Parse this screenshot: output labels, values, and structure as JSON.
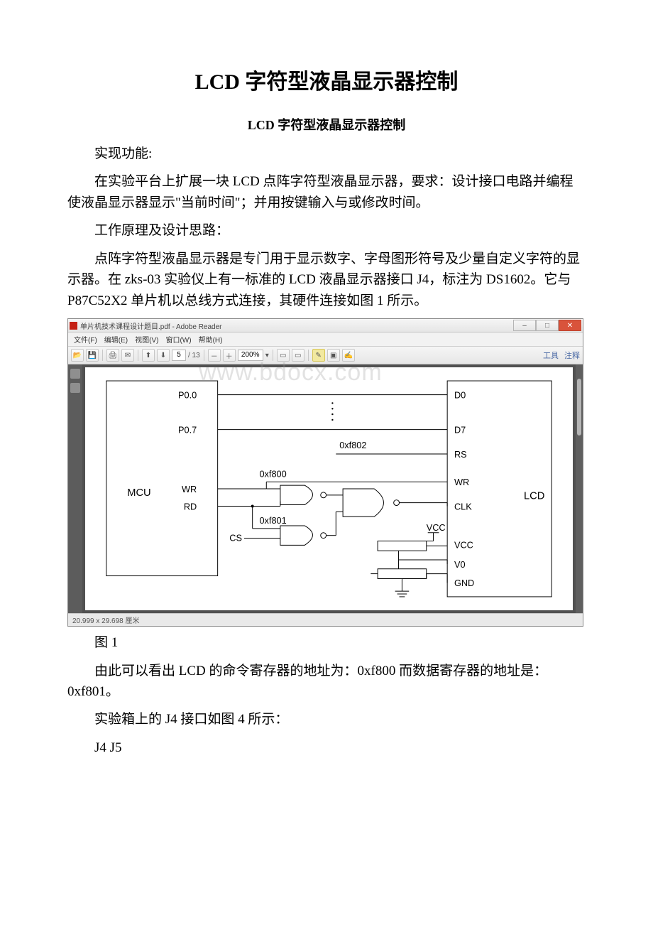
{
  "doc": {
    "title_main": "LCD 字符型液晶显示器控制",
    "subtitle": "LCD 字符型液晶显示器控制",
    "p_func_h": "实现功能:",
    "p_func_body": "在实验平台上扩展一块 LCD 点阵字符型液晶显示器，要求：设计接口电路并编程使液晶显示器显示\"当前时间\"；并用按键输入与或修改时间。",
    "p_principle_h": "工作原理及设计思路：",
    "p_principle_body": "点阵字符型液晶显示器是专门用于显示数字、字母图形符号及少量自定义字符的显示器。在 zks-03 实验仪上有一标准的 LCD 液晶显示器接口 J4，标注为 DS1602。它与 P87C52X2 单片机以总线方式连接，其硬件连接如图 1 所示。",
    "fig1_caption": "图 1",
    "p_conclusion": "由此可以看出 LCD 的命令寄存器的地址为：0xf800 而数据寄存器的地址是：0xf801。",
    "p_j4": "实验箱上的 J4 接口如图 4 所示：",
    "p_j4j5": "J4 J5"
  },
  "adobe": {
    "window_title": "单片机技术课程设计题目.pdf - Adobe Reader",
    "menu": [
      "文件(F)",
      "编辑(E)",
      "视图(V)",
      "窗口(W)",
      "帮助(H)"
    ],
    "page_current": "5",
    "page_total": "/ 13",
    "zoom": "200%",
    "right_links": [
      "工具",
      "注释"
    ],
    "status": "20.999 x 29.698 厘米"
  },
  "circuit": {
    "mcu": "MCU",
    "lcd": "LCD",
    "p00": "P0.0",
    "p07": "P0.7",
    "wr": "WR",
    "rd": "RD",
    "cs": "CS",
    "d0": "D0",
    "d7": "D7",
    "rs": "RS",
    "wr_r": "WR",
    "clk": "CLK",
    "vcc_top": "VCC",
    "vcc": "VCC",
    "v0": "V0",
    "gnd": "GND",
    "addr_a": "0xf800",
    "addr_b": "0xf801",
    "addr_c": "0xf802"
  },
  "watermark": "www.bdocx.com"
}
